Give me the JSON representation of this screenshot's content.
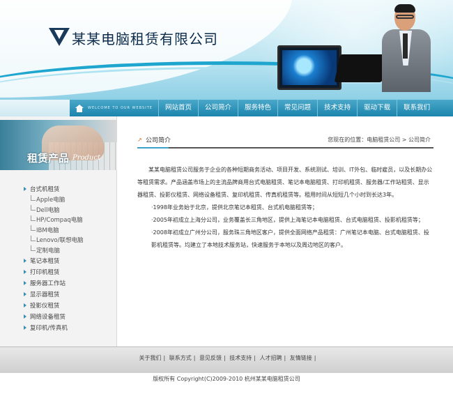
{
  "header": {
    "company_name": "某某电脑租赁有限公司"
  },
  "nav": {
    "welcome": "WELCOME TO OUR WEBSITE",
    "items": [
      "网站首页",
      "公司简介",
      "服务特色",
      "常见问题",
      "技术支持",
      "驱动下载",
      "联系我们"
    ]
  },
  "sidebar": {
    "title": "租赁产品",
    "title_en": "Product",
    "categories": [
      {
        "label": "台式机租赁",
        "subs": [
          "Apple电脑",
          "Dell电脑",
          "HP/Compaq电脑",
          "IBM电脑",
          "Lenovo/联想电脑",
          "定制电脑"
        ]
      },
      {
        "label": "笔记本租赁"
      },
      {
        "label": "打印机租赁"
      },
      {
        "label": "服务器工作站"
      },
      {
        "label": "显示器租赁"
      },
      {
        "label": "投影仪租赁"
      },
      {
        "label": "网络设备租赁"
      },
      {
        "label": "复印机/传真机"
      }
    ]
  },
  "content": {
    "title": "公司简介",
    "breadcrumb": "您现在的位置：电脑租赁公司 > 公司简介",
    "paragraphs": [
      "某某电脑租赁公司服务于企业的各种短期商务活动、项目开发、系统测试、培训、IT外包、临时雇员，以及长期办公等租赁需求。产品涵盖市场上的主流品牌商用台式电脑租赁、笔记本电脑租赁、打印机租赁、服务器/工作站租赁、显示器租赁、投影仪租赁、网络设备租赁、复印机租赁、传真机租赁等。租用时间从短短几个小时到长达3年。",
      "·1998年业务始于北京，提供北京笔记本租赁、台式机电脑租赁等；",
      "·2005年初成立上海分公司，业务覆盖长三角地区，提供上海笔记本电脑租赁、台式电脑租赁、投影机租赁等；",
      "·2008年初成立广州分公司，服务珠三角地区客户，提供全面网络产品租赁：广州笔记本电脑、台式电脑租赁、投影机租赁等。均建立了本地技术服务站，快速服务于本地以及周边地区的客户。"
    ]
  },
  "footer": {
    "links": [
      "关于我们",
      "联系方式",
      "意见反馈",
      "技术支持",
      "人才招聘",
      "友情链接"
    ],
    "copyright": "版权所有 Copyright(C)2009-2010 杭州某某电脑租赁公司"
  }
}
